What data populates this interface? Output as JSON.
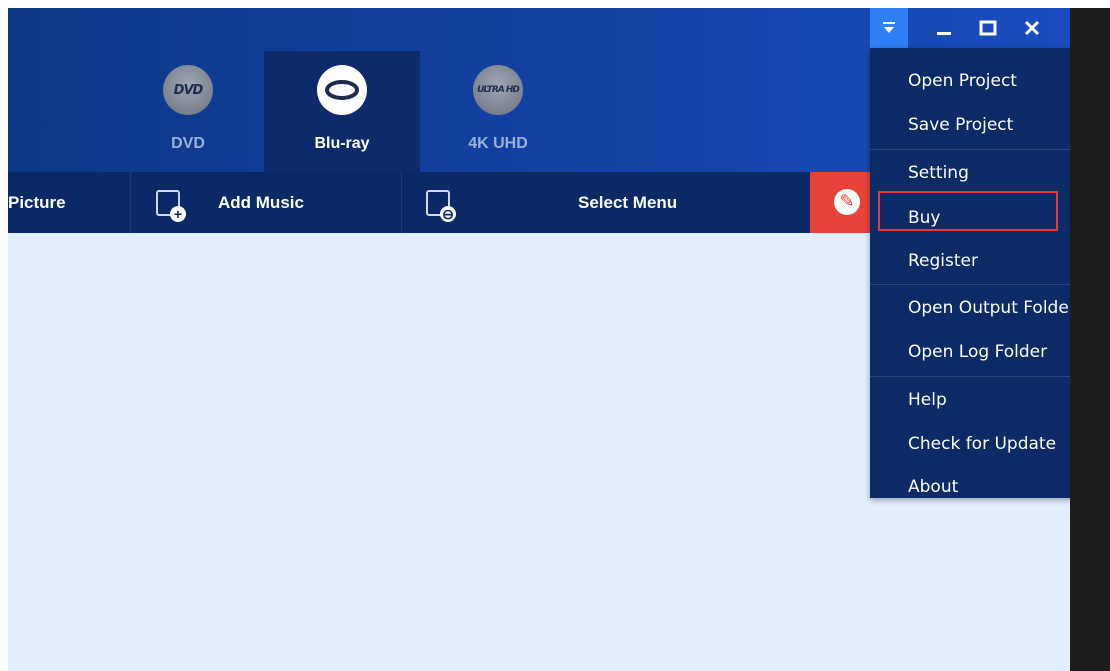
{
  "tabs": [
    {
      "label": "DVD",
      "logo": "DVD",
      "active": false
    },
    {
      "label": "Blu-ray",
      "logo": "bluray-disc",
      "active": true
    },
    {
      "label": "4K UHD",
      "logo": "ULTRA HD",
      "active": false
    }
  ],
  "toolbar": {
    "picture_label": "Picture",
    "add_music_label": "Add Music",
    "select_menu_label": "Select Menu"
  },
  "window": {
    "minimize": "_",
    "maximize": "□",
    "close": "✕"
  },
  "menu": {
    "items": [
      {
        "label": "Open Project"
      },
      {
        "label": "Save Project"
      },
      {
        "label": "Setting"
      },
      {
        "label": "Buy"
      },
      {
        "label": "Register"
      },
      {
        "label": "Open Output Folder"
      },
      {
        "label": "Open Log Folder"
      },
      {
        "label": "Help"
      },
      {
        "label": "Check for Update"
      },
      {
        "label": "About"
      }
    ],
    "highlighted_item": "Buy"
  },
  "colors": {
    "header": "#1443a6",
    "toolbar": "#0b2966",
    "menu_bg": "#0c2a66",
    "accent": "#2f7ff5",
    "red_button": "#e8423a",
    "highlight_border": "#e33a3a",
    "workspace": "#e3efff"
  }
}
